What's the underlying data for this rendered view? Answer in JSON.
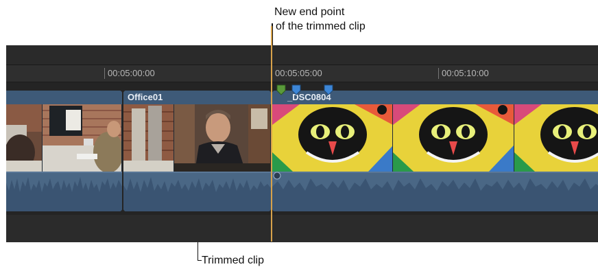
{
  "callouts": {
    "top_line1": "New end point",
    "top_line2": "of the trimmed clip",
    "bottom": "Trimmed clip"
  },
  "ruler": {
    "timecodes": [
      "00:05:00:00",
      "00:05:05:00",
      "00:05:10:00"
    ]
  },
  "clips": [
    {
      "name": ""
    },
    {
      "name": "Office01"
    },
    {
      "name": "_DSC0804"
    }
  ],
  "colors": {
    "timeline_bg": "#262626",
    "clip_blue": "#5a7797",
    "clip_header": "#3e5a78",
    "playhead": "#d8a24a",
    "marker_green": "#5a9a3a",
    "marker_blue": "#3d86d6"
  }
}
